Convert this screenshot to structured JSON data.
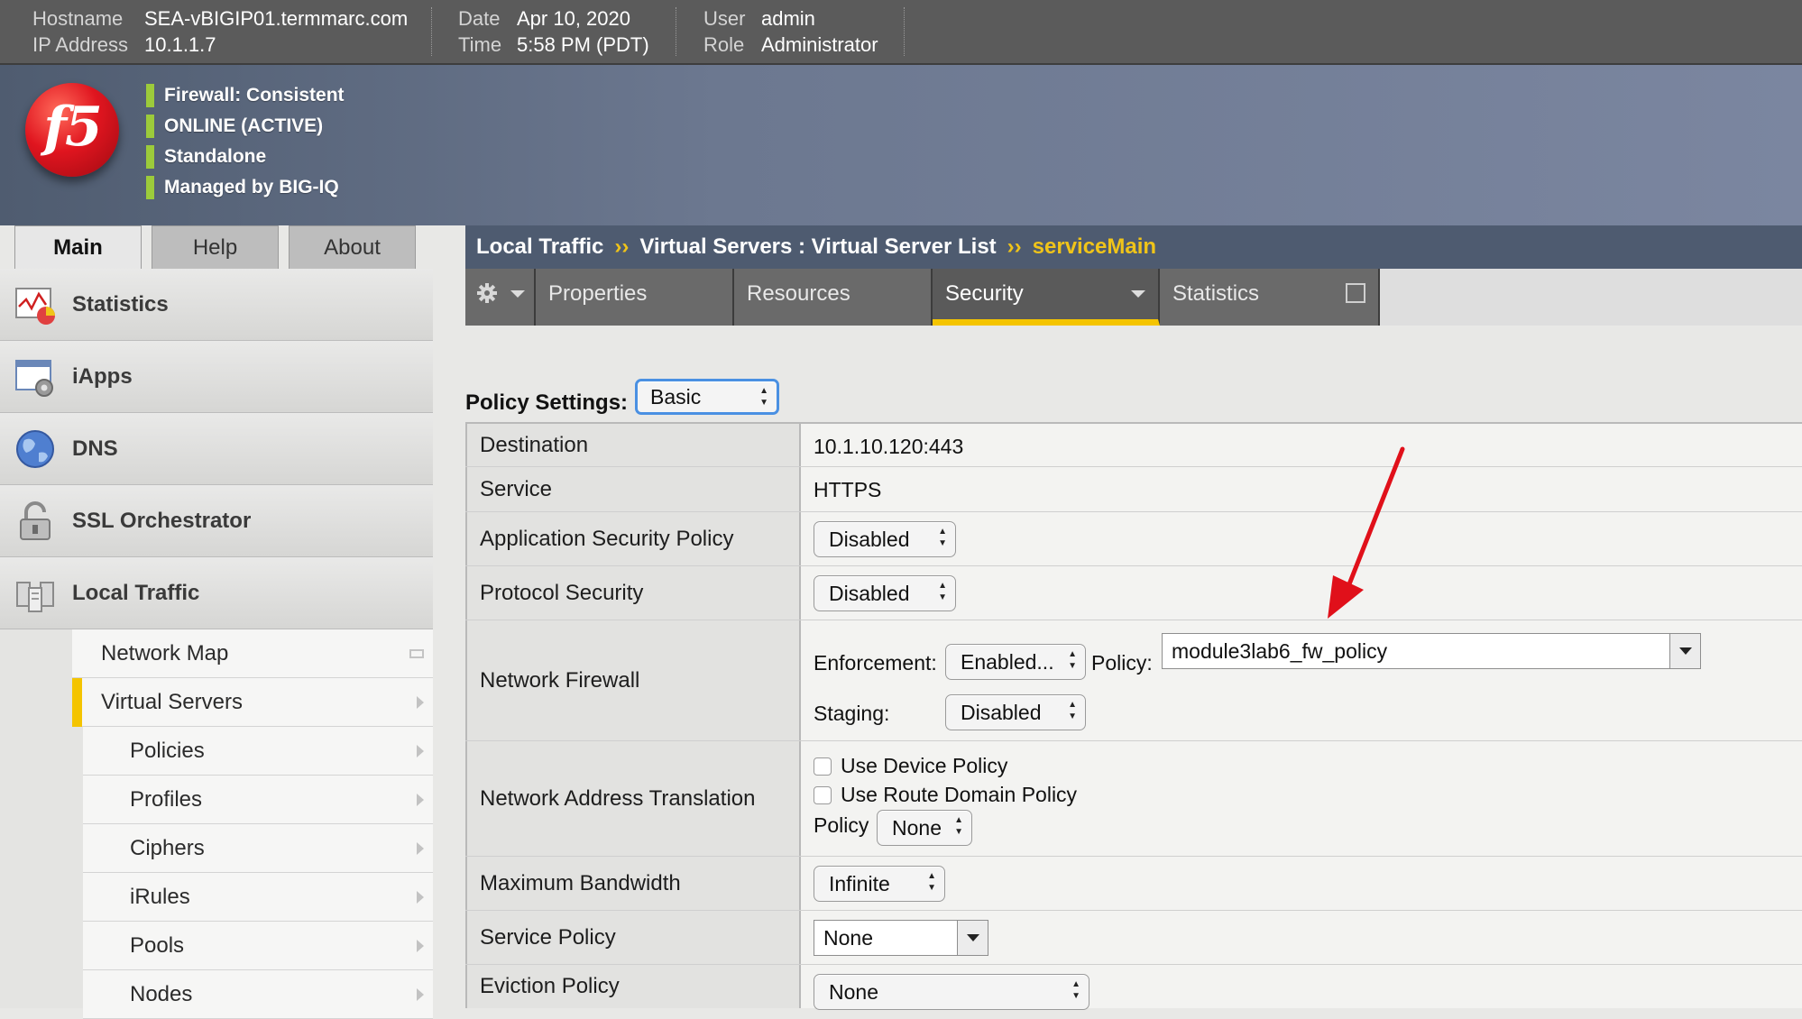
{
  "header": {
    "hostname_label": "Hostname",
    "hostname": "SEA-vBIGIP01.termmarc.com",
    "ip_label": "IP Address",
    "ip": "10.1.1.7",
    "date_label": "Date",
    "date": "Apr 10, 2020",
    "time_label": "Time",
    "time": "5:58 PM (PDT)",
    "user_label": "User",
    "user": "admin",
    "role_label": "Role",
    "role": "Administrator"
  },
  "banner": {
    "logo_text": "f5",
    "status": [
      "Firewall: Consistent",
      "ONLINE (ACTIVE)",
      "Standalone",
      "Managed by BIG-IQ"
    ],
    "status_color": "#9ccb3b"
  },
  "main_tabs": [
    "Main",
    "Help",
    "About"
  ],
  "sidebar": {
    "sections": [
      {
        "label": "Statistics",
        "icon": "statistics-icon"
      },
      {
        "label": "iApps",
        "icon": "iapps-icon"
      },
      {
        "label": "DNS",
        "icon": "dns-globe-icon"
      },
      {
        "label": "SSL Orchestrator",
        "icon": "padlock-icon"
      },
      {
        "label": "Local Traffic",
        "icon": "local-traffic-icon"
      }
    ],
    "subitems": [
      {
        "label": "Network Map"
      },
      {
        "label": "Virtual Servers"
      },
      {
        "label": "Policies"
      },
      {
        "label": "Profiles"
      },
      {
        "label": "Ciphers"
      },
      {
        "label": "iRules"
      },
      {
        "label": "Pools"
      },
      {
        "label": "Nodes"
      }
    ],
    "active_color": "#f4c400"
  },
  "breadcrumb": {
    "part1": "Local Traffic",
    "sep": "››",
    "part2": "Virtual Servers : Virtual Server List",
    "current": "serviceMain"
  },
  "subtabs": [
    "Properties",
    "Resources",
    "Security",
    "Statistics"
  ],
  "content": {
    "policy_settings_label": "Policy Settings:",
    "policy_settings_value": "Basic",
    "rows": {
      "destination": {
        "label": "Destination",
        "value": "10.1.10.120:443"
      },
      "service": {
        "label": "Service",
        "value": "HTTPS"
      },
      "asp": {
        "label": "Application Security Policy",
        "value": "Disabled"
      },
      "protocol": {
        "label": "Protocol Security",
        "value": "Disabled"
      },
      "firewall": {
        "label": "Network Firewall",
        "enforcement_label": "Enforcement:",
        "enforcement": "Enabled...",
        "policy_label": "Policy:",
        "policy": "module3lab6_fw_policy",
        "staging_label": "Staging:",
        "staging": "Disabled"
      },
      "nat": {
        "label": "Network Address Translation",
        "use_device": "Use Device Policy",
        "use_route": "Use Route Domain Policy",
        "policy_label": "Policy",
        "policy": "None"
      },
      "bandwidth": {
        "label": "Maximum Bandwidth",
        "value": "Infinite"
      },
      "service_policy": {
        "label": "Service Policy",
        "value": "None"
      },
      "eviction": {
        "label": "Eviction Policy",
        "value": "None"
      }
    }
  },
  "colors": {
    "accent_yellow": "#f4c400",
    "breadcrumb_bg": "#4e5b70",
    "annotation_red": "#e0101a"
  }
}
